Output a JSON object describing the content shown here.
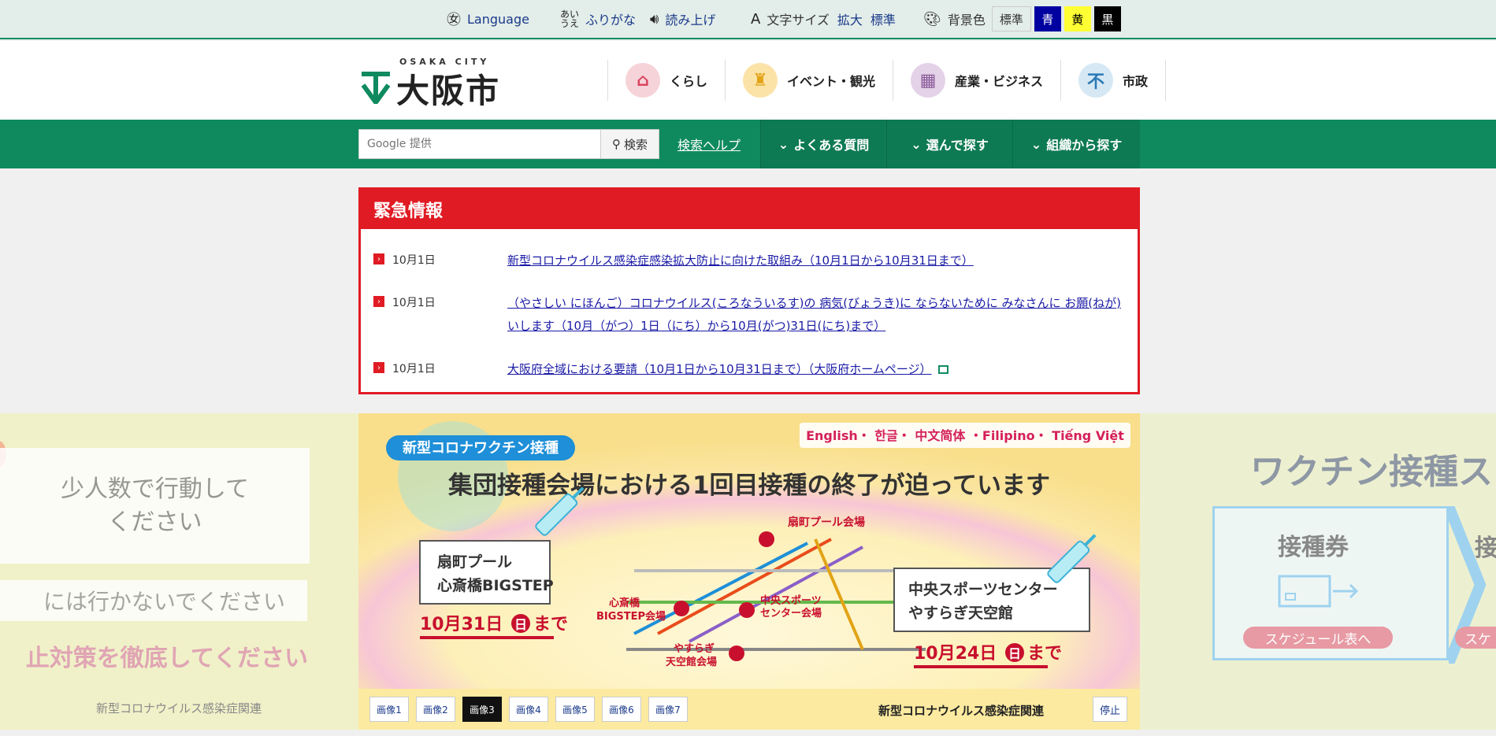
{
  "utility": {
    "language": "Language",
    "furigana": "ふりがな",
    "read_aloud": "読み上げ",
    "text_size_label": "文字サイズ",
    "text_size_large": "拡大",
    "text_size_standard": "標準",
    "bg_label": "背景色",
    "bg_options": [
      "標準",
      "青",
      "黄",
      "黒"
    ]
  },
  "header": {
    "logo_sub": "OSAKA CITY",
    "logo_name": "大阪市",
    "nav": [
      {
        "label": "くらし",
        "icon": "house-icon",
        "color": "#f6d3d8"
      },
      {
        "label": "イベント・観光",
        "icon": "castle-icon",
        "color": "#fbe3a8"
      },
      {
        "label": "産業・ビジネス",
        "icon": "building-icon",
        "color": "#e4d2e8"
      },
      {
        "label": "市政",
        "icon": "city-emblem-icon",
        "color": "#d6e8f3"
      }
    ]
  },
  "greenbar": {
    "search_placeholder": "Google 提供",
    "search_button": "検索",
    "search_help": "検索ヘルプ",
    "faq": "よくある質問",
    "choose": "選んで探す",
    "org": "組織から探す"
  },
  "emergency": {
    "title": "緊急情報",
    "items": [
      {
        "date": "10月1日",
        "text": "新型コロナウイルス感染症感染拡大防止に向けた取組み（10月1日から10月31日まで）"
      },
      {
        "date": "10月1日",
        "text": "（やさしい にほんご）コロナウイルス(ころなういるす)の 病気(びょうき)に ならないために みなさんに お願(ねが)いします（10月（がつ）1日（にち）から10月(がつ)31日(にち)まで）"
      },
      {
        "date": "10月1日",
        "text": "大阪府全域における要請（10月1日から10月31日まで）（大阪府ホームページ）"
      }
    ]
  },
  "carousel": {
    "left": {
      "box1": "少人数で行動して\nください",
      "box2": "には行かないでください",
      "pink": "止対策を徹底してください",
      "caption": "新型コロナウイルス感染症関連"
    },
    "main": {
      "badge": "新型コロナワクチン接種",
      "langs": "English・ 한글・ 中文简体 ・Filipino・ Tiếng Việt",
      "headline": "集団接種会場における1回目接種の終了が迫っています",
      "venue_left": "扇町プール\n心斎橋BIGSTEP",
      "date_left": "10月31日",
      "date_left_day": "日",
      "date_left_suffix": "まで",
      "venue_right": "中央スポーツセンター\nやすらぎ天空館",
      "date_right": "10月24日",
      "date_right_day": "日",
      "date_right_suffix": "まで",
      "map_labels": [
        "扇町プール会場",
        "心斎橋\nBIGSTEP会場",
        "中央スポーツ\nセンター会場",
        "やすらぎ\n天空館会場"
      ]
    },
    "right": {
      "title": "ワクチン接種ス",
      "panel_title": "接種券",
      "panel_button": "スケジュール表へ",
      "panel2_title": "接",
      "panel2_button": "スケ"
    },
    "pills": [
      "画像1",
      "画像2",
      "画像3",
      "画像4",
      "画像5",
      "画像6",
      "画像7"
    ],
    "active_pill": 2,
    "caption": "新型コロナウイルス感染症関連",
    "stop": "停止"
  }
}
